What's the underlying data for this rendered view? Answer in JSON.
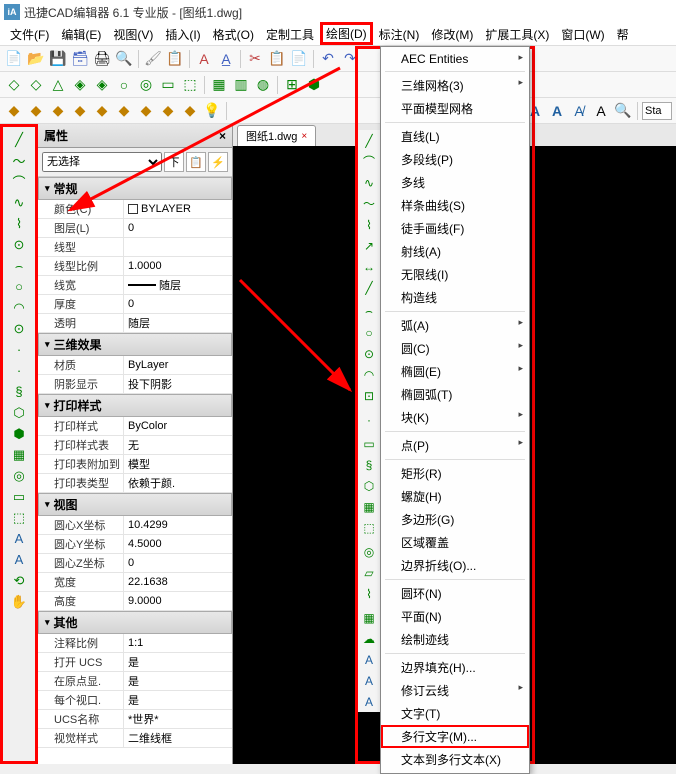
{
  "title": "迅捷CAD编辑器 6.1 专业版  - [图纸1.dwg]",
  "menubar": [
    "文件(F)",
    "编辑(E)",
    "视图(V)",
    "插入(I)",
    "格式(O)",
    "定制工具",
    "绘图(D)",
    "标注(N)",
    "修改(M)",
    "扩展工具(X)",
    "窗口(W)",
    "帮"
  ],
  "menubar_highlight_index": 6,
  "toolbar3_search": "Sta",
  "doc_tab": "图纸1.dwg",
  "props": {
    "title": "属性",
    "selector": "无选择",
    "filter_btn": "下",
    "groups": [
      {
        "name": "常规",
        "rows": [
          {
            "label": "颜色(C)",
            "value": "BYLAYER",
            "swatch": true
          },
          {
            "label": "图层(L)",
            "value": "0"
          },
          {
            "label": "线型",
            "value": ""
          },
          {
            "label": "线型比例",
            "value": "1.0000"
          },
          {
            "label": "线宽",
            "value": "随层",
            "line": true
          },
          {
            "label": "厚度",
            "value": "0"
          },
          {
            "label": "透明",
            "value": "随层"
          }
        ]
      },
      {
        "name": "三维效果",
        "rows": [
          {
            "label": "材质",
            "value": "ByLayer"
          },
          {
            "label": "阴影显示",
            "value": "投下阴影"
          }
        ]
      },
      {
        "name": "打印样式",
        "rows": [
          {
            "label": "打印样式",
            "value": "ByColor"
          },
          {
            "label": "打印样式表",
            "value": "无"
          },
          {
            "label": "打印表附加到",
            "value": "模型"
          },
          {
            "label": "打印表类型",
            "value": "依赖于颜."
          }
        ]
      },
      {
        "name": "视图",
        "rows": [
          {
            "label": "圆心X坐标",
            "value": "10.4299"
          },
          {
            "label": "圆心Y坐标",
            "value": "4.5000"
          },
          {
            "label": "圆心Z坐标",
            "value": "0"
          },
          {
            "label": "宽度",
            "value": "22.1638"
          },
          {
            "label": "高度",
            "value": "9.0000"
          }
        ]
      },
      {
        "name": "其他",
        "rows": [
          {
            "label": "注释比例",
            "value": "1:1"
          },
          {
            "label": "打开 UCS",
            "value": "是"
          },
          {
            "label": "在原点显.",
            "value": "是"
          },
          {
            "label": "每个视口.",
            "value": "是"
          },
          {
            "label": "UCS名称",
            "value": "*世界*"
          },
          {
            "label": "视觉样式",
            "value": "二维线框"
          }
        ]
      }
    ]
  },
  "draw_menu": [
    {
      "label": "AEC Entities",
      "sub": true
    },
    {
      "sep": true
    },
    {
      "label": "三维网格(3)",
      "sub": true
    },
    {
      "label": "平面模型网格"
    },
    {
      "sep": true
    },
    {
      "label": "直线(L)"
    },
    {
      "label": "多段线(P)"
    },
    {
      "label": "多线"
    },
    {
      "label": "样条曲线(S)"
    },
    {
      "label": "徒手画线(F)"
    },
    {
      "label": "射线(A)"
    },
    {
      "label": "无限线(I)"
    },
    {
      "label": "构造线"
    },
    {
      "sep": true
    },
    {
      "label": "弧(A)",
      "sub": true
    },
    {
      "label": "圆(C)",
      "sub": true
    },
    {
      "label": "椭圆(E)",
      "sub": true
    },
    {
      "label": "椭圆弧(T)"
    },
    {
      "label": "块(K)",
      "sub": true
    },
    {
      "sep": true
    },
    {
      "label": "点(P)",
      "sub": true
    },
    {
      "sep": true
    },
    {
      "label": "矩形(R)"
    },
    {
      "label": "螺旋(H)"
    },
    {
      "label": "多边形(G)"
    },
    {
      "label": "区域覆盖"
    },
    {
      "label": "边界折线(O)..."
    },
    {
      "sep": true
    },
    {
      "label": "圆环(N)"
    },
    {
      "label": "平面(N)"
    },
    {
      "label": "绘制迹线"
    },
    {
      "sep": true
    },
    {
      "label": "边界填充(H)..."
    },
    {
      "label": "修订云线",
      "sub": true
    },
    {
      "label": "文字(T)"
    },
    {
      "label": "多行文字(M)...",
      "hl": true
    },
    {
      "label": "文本到多行文本(X)"
    }
  ],
  "left_tools": [
    "╱",
    "〜",
    "⌒",
    "∿",
    "⌇",
    "⊙",
    "⌢",
    "○",
    "◠",
    "⊙",
    "·",
    "·",
    "§",
    "⬡",
    "⬢",
    "▦",
    "◎",
    "▭",
    "⬚",
    "A",
    "A",
    "⟲",
    "✋"
  ],
  "draw_side_icons": [
    "╱",
    "⌒",
    "∿",
    "〜",
    "⌇",
    "↗",
    "↔",
    "╱",
    "",
    "⌢",
    "○",
    "⊙",
    "◠",
    "⊡",
    "",
    "·",
    "",
    "▭",
    "§",
    "⬡",
    "▦",
    "⬚",
    "",
    "◎",
    "▱",
    "⌇",
    "",
    "▦",
    "☁",
    "A",
    "A",
    "A"
  ]
}
